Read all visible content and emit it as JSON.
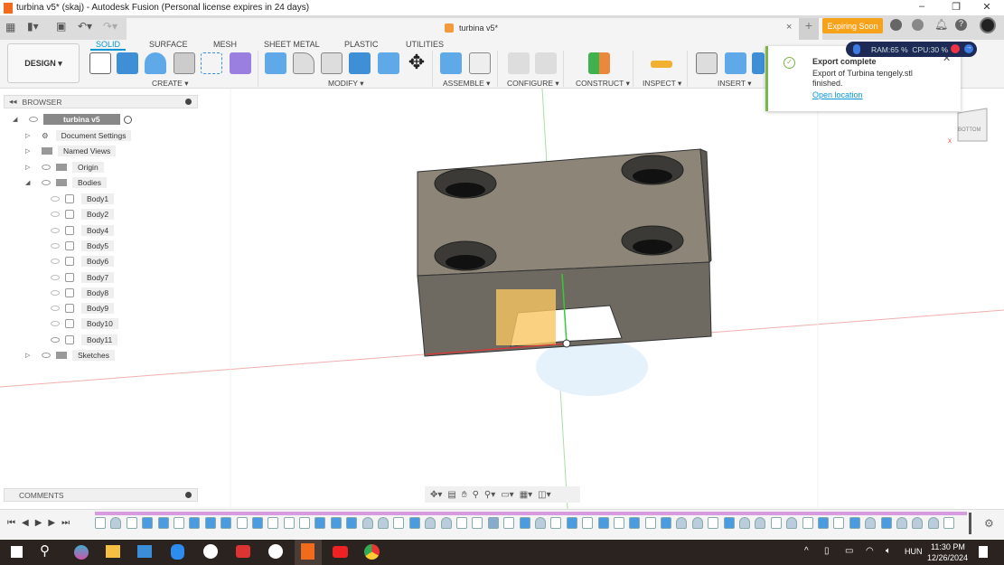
{
  "window": {
    "title": "turbina v5* (skaj) - Autodesk Fusion (Personal license expires in 24 days)",
    "minimize": "–",
    "restore": "❐",
    "close": "✕"
  },
  "document_tab": {
    "name": "turbina v5*",
    "close": "×",
    "new_tab": "+"
  },
  "header": {
    "expiring_label": "Expiring Soon"
  },
  "ribbon": {
    "workspace": "DESIGN ▾",
    "tabs": [
      {
        "label": "SOLID",
        "active": true
      },
      {
        "label": "SURFACE"
      },
      {
        "label": "MESH"
      },
      {
        "label": "SHEET METAL"
      },
      {
        "label": "PLASTIC"
      },
      {
        "label": "UTILITIES"
      }
    ],
    "groups": [
      "CREATE ▾",
      "MODIFY ▾",
      "ASSEMBLE ▾",
      "CONFIGURE ▾",
      "CONSTRUCT ▾",
      "INSPECT ▾",
      "INSERT ▾"
    ]
  },
  "browser": {
    "title": "BROWSER",
    "root": "turbina v5",
    "items": [
      {
        "label": "Document Settings",
        "icon": "gear-icon"
      },
      {
        "label": "Named Views",
        "icon": "folder-icon"
      },
      {
        "label": "Origin",
        "icon": "folder-icon"
      },
      {
        "label": "Bodies",
        "icon": "folder-icon",
        "expanded": true
      }
    ],
    "bodies": [
      {
        "label": "Body1",
        "visible": false
      },
      {
        "label": "Body2",
        "visible": false
      },
      {
        "label": "Body4",
        "visible": false
      },
      {
        "label": "Body5",
        "visible": false
      },
      {
        "label": "Body6",
        "visible": false
      },
      {
        "label": "Body7",
        "visible": false
      },
      {
        "label": "Body8",
        "visible": false
      },
      {
        "label": "Body9",
        "visible": false
      },
      {
        "label": "Body10",
        "visible": false
      },
      {
        "label": "Body11",
        "visible": true
      }
    ],
    "sketches": "Sketches"
  },
  "notification": {
    "title": "Export complete",
    "message": "Export of Turbina tengely.stl finished.",
    "link": "Open location",
    "close": "✕"
  },
  "monitor": {
    "ram": "RAM:65 %",
    "cpu": "CPU:30 %"
  },
  "viewcube": {
    "face": "BOTTOM",
    "axis": "X"
  },
  "comments": {
    "title": "COMMENTS"
  },
  "timeline": {
    "features": [
      "sketch",
      "revolve",
      "sketch",
      "extrude",
      "extrude",
      "sketch",
      "extrude",
      "extrude",
      "extrude",
      "sketch",
      "extrude",
      "sketch",
      "sketch",
      "sketch",
      "extrude",
      "extrude",
      "extrude",
      "revolve",
      "revolve",
      "sketch",
      "extrude",
      "revolve",
      "revolve",
      "sketch",
      "sketch",
      "edit",
      "sketch",
      "extrude",
      "revolve",
      "sketch",
      "extrude",
      "sketch",
      "extrude",
      "sketch",
      "extrude",
      "sketch",
      "extrude",
      "revolve",
      "revolve",
      "sketch",
      "extrude",
      "revolve",
      "revolve",
      "sketch",
      "revolve",
      "sketch",
      "extrude",
      "sketch",
      "extrude",
      "revolve",
      "extrude",
      "revolve",
      "revolve",
      "revolve",
      "sketch"
    ]
  },
  "taskbar": {
    "time": "11:30 PM",
    "date": "12/26/2024",
    "language": "HUN"
  },
  "colors": {
    "accent": "#0696d7",
    "expiring": "#f7a21b",
    "timeline": "#d99be0",
    "success": "#7ab648"
  }
}
